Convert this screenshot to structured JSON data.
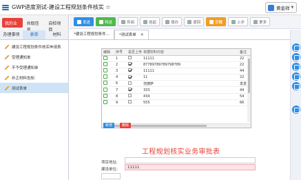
{
  "window": {
    "title": "GWP进度测试-建设工程规划条件核实 ☆"
  },
  "user": {
    "name": "黄金祥"
  },
  "left": {
    "top_tabs": [
      "我的业务",
      "共取信息",
      "自检项目"
    ],
    "sub_tabs": [
      "办理事项",
      "表单",
      "材料"
    ],
    "items": [
      "建设工程规划条件核实申请表",
      "受理通知单",
      "不予受理通知单",
      "补正材料告知",
      "测试表单"
    ]
  },
  "toolbar": {
    "buttons": [
      "发送",
      "特送",
      "传阅",
      "挂起",
      "填办",
      "退回",
      "提醒",
      "上步",
      "更多"
    ]
  },
  "doctabs": {
    "tab1": "*建设工程规划条件...",
    "tab2": "*测试表单"
  },
  "grid": {
    "columns": [
      "编辑",
      "序号",
      "是否上传",
      "单据材料内容",
      "备注"
    ],
    "rows": [
      {
        "no": "1",
        "checked": false,
        "content": "11111",
        "note": "22"
      },
      {
        "no": "2",
        "checked": true,
        "content": "87789789789798789",
        "note": "22"
      },
      {
        "no": "3",
        "checked": true,
        "content": "11111",
        "note": "44"
      },
      {
        "no": "4",
        "checked": true,
        "content": "11",
        "note": "22"
      },
      {
        "no": "6",
        "checked": false,
        "content": "范德萨",
        "note": "发发"
      },
      {
        "no": "7",
        "checked": true,
        "content": "333",
        "note": "44"
      },
      {
        "no": "8",
        "checked": false,
        "content": "434",
        "note": "54"
      },
      {
        "no": "9",
        "checked": false,
        "content": "555",
        "note": "66"
      }
    ],
    "add_label": "新增",
    "delete_label": "删除"
  },
  "form": {
    "title": "工程规划核实业务审批表",
    "project_address_label": "项目地址:",
    "project_address_value": "",
    "applicant_label": "建设单位:",
    "applicant_value": "11111"
  }
}
